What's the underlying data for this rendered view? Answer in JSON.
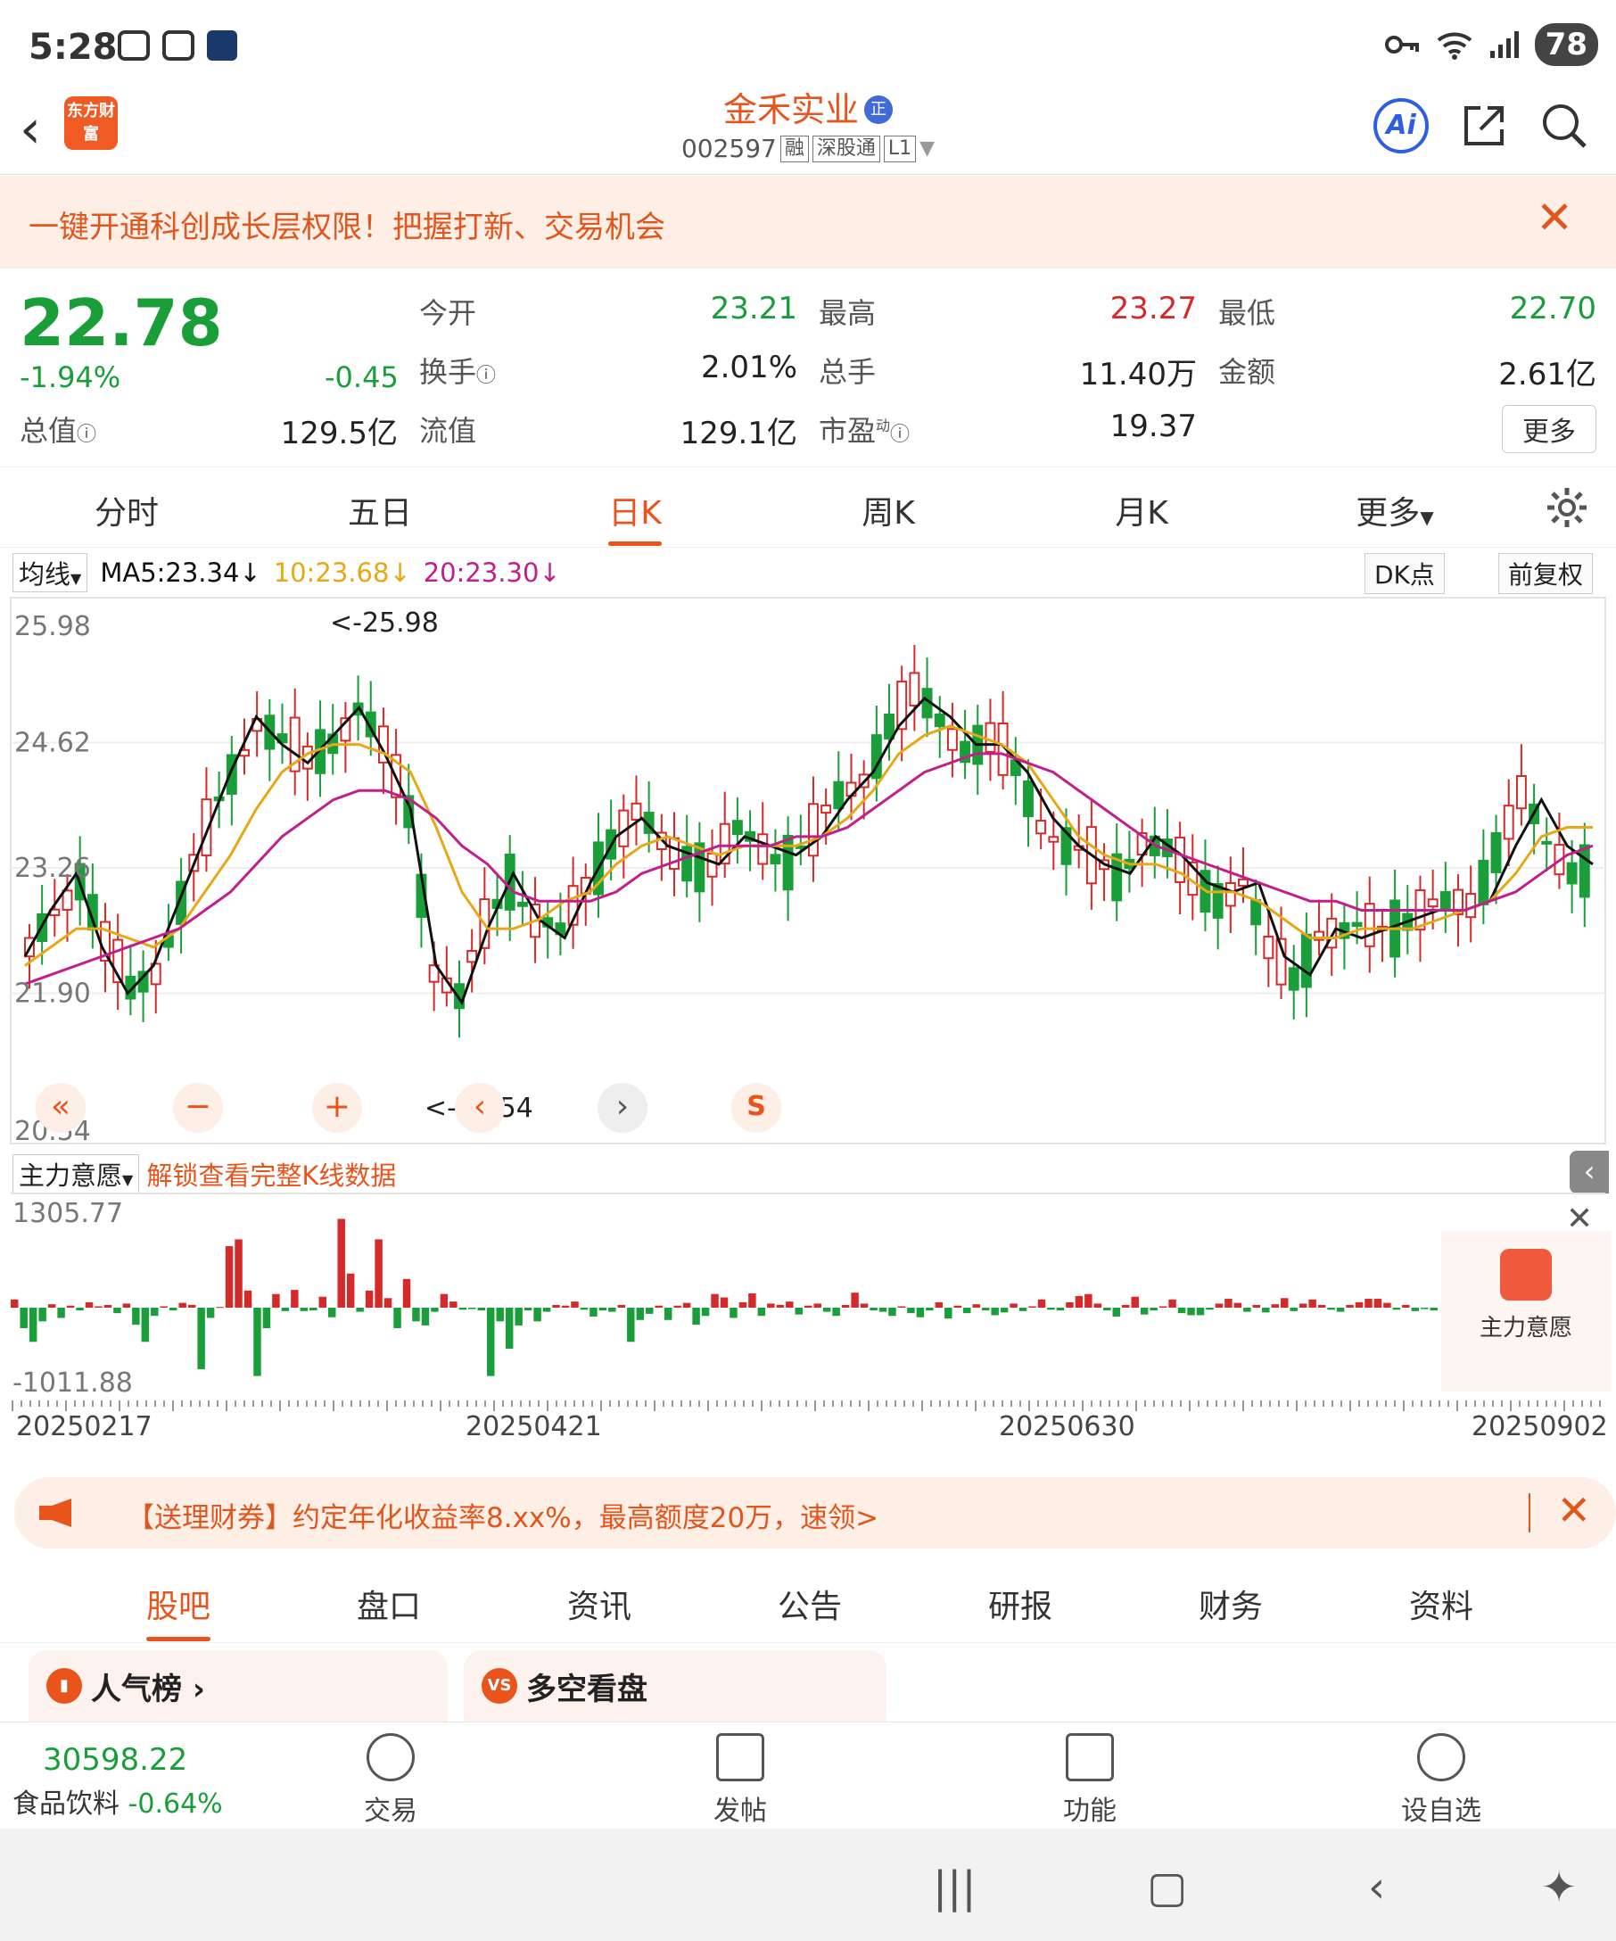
{
  "status": {
    "time": "5:28",
    "battery": "78"
  },
  "header": {
    "logo_text": "东方财富",
    "title": "金禾实业",
    "title_badge": "正",
    "code": "002597",
    "tags": [
      "融",
      "深股通",
      "L1"
    ],
    "ai_label": "Ai"
  },
  "banner": {
    "text": "一键开通科创成长层权限！把握打新、交易机会"
  },
  "quote": {
    "price": "22.78",
    "change_pct": "-1.94%",
    "change": "-0.45",
    "open_label": "今开",
    "open": "23.21",
    "high_label": "最高",
    "high": "23.27",
    "low_label": "最低",
    "low": "22.70",
    "turnover_label": "换手",
    "turnover": "2.01%",
    "volume_label": "总手",
    "volume": "11.40万",
    "amount_label": "金额",
    "amount": "2.61亿",
    "mktcap_label": "总值",
    "mktcap": "129.5亿",
    "float_label": "流值",
    "float": "129.1亿",
    "pe_label": "市盈",
    "pe_sup": "动",
    "pe": "19.37",
    "more": "更多"
  },
  "tabs": [
    "分时",
    "五日",
    "日K",
    "周K",
    "月K",
    "更多"
  ],
  "active_tab": "日K",
  "ma_legend": {
    "selector": "均线",
    "ma5": "MA5:23.34↓",
    "ma10": "10:23.68↓",
    "ma20": "20:23.30↓",
    "dk": "DK点",
    "fq": "前复权"
  },
  "chart_data": {
    "type": "candlestick",
    "yticks": [
      "25.98",
      "24.62",
      "23.26",
      "21.90",
      "20.54"
    ],
    "ylim": [
      20.54,
      25.98
    ],
    "max_label": "25.98",
    "min_label": "20.54",
    "colors": {
      "up": "#d42a2a",
      "down": "#1a9e3a",
      "ma5": "#111111",
      "ma10": "#e6a817",
      "ma20": "#c21f8a"
    },
    "ma5_approx": [
      22.3,
      22.8,
      23.2,
      22.4,
      21.9,
      22.2,
      22.9,
      23.6,
      24.3,
      24.9,
      24.6,
      24.4,
      24.7,
      25.0,
      24.5,
      23.9,
      22.2,
      21.8,
      22.6,
      23.2,
      22.7,
      22.5,
      23.1,
      23.6,
      23.8,
      23.5,
      23.4,
      23.3,
      23.6,
      23.5,
      23.4,
      23.6,
      24.0,
      24.3,
      24.8,
      25.1,
      24.9,
      24.6,
      24.6,
      24.3,
      23.8,
      23.5,
      23.3,
      23.2,
      23.6,
      23.4,
      23.1,
      23.0,
      23.1,
      22.3,
      22.1,
      22.6,
      22.5,
      22.6,
      22.7,
      22.8,
      22.8,
      22.9,
      23.5,
      24.0,
      23.5,
      23.3
    ],
    "ma10_approx": [
      22.2,
      22.4,
      22.6,
      22.6,
      22.5,
      22.4,
      22.6,
      23.0,
      23.4,
      23.9,
      24.3,
      24.5,
      24.6,
      24.6,
      24.5,
      24.3,
      23.7,
      23.0,
      22.6,
      22.6,
      22.7,
      22.9,
      23.0,
      23.3,
      23.5,
      23.6,
      23.5,
      23.4,
      23.5,
      23.5,
      23.5,
      23.6,
      23.8,
      24.1,
      24.5,
      24.7,
      24.8,
      24.7,
      24.6,
      24.4,
      24.0,
      23.6,
      23.4,
      23.3,
      23.3,
      23.2,
      23.0,
      23.0,
      22.9,
      22.7,
      22.5,
      22.5,
      22.6,
      22.6,
      22.6,
      22.7,
      22.8,
      22.9,
      23.2,
      23.6,
      23.7,
      23.7
    ],
    "ma20_approx": [
      22.0,
      22.1,
      22.2,
      22.3,
      22.4,
      22.5,
      22.6,
      22.8,
      23.0,
      23.3,
      23.6,
      23.8,
      24.0,
      24.1,
      24.1,
      24.0,
      23.8,
      23.5,
      23.3,
      23.0,
      22.9,
      22.9,
      22.9,
      23.0,
      23.2,
      23.3,
      23.4,
      23.5,
      23.5,
      23.5,
      23.6,
      23.6,
      23.7,
      23.9,
      24.1,
      24.3,
      24.4,
      24.5,
      24.5,
      24.4,
      24.3,
      24.1,
      23.9,
      23.7,
      23.5,
      23.4,
      23.3,
      23.2,
      23.1,
      23.0,
      22.9,
      22.9,
      22.8,
      22.8,
      22.8,
      22.8,
      22.8,
      22.9,
      23.0,
      23.2,
      23.4,
      23.5
    ]
  },
  "chart_controls": [
    "«",
    "−",
    "+",
    "‹",
    "›",
    "S"
  ],
  "volume_panel": {
    "selector": "主力意愿",
    "unlock": "解锁查看完整K线数据",
    "ymax": "1305.77",
    "ymin": "-1011.88",
    "side_label": "主力意愿",
    "values": [
      120,
      -300,
      -500,
      -200,
      50,
      -150,
      30,
      -40,
      80,
      20,
      40,
      -80,
      60,
      -250,
      -500,
      -120,
      20,
      -40,
      70,
      40,
      -900,
      -150,
      10,
      900,
      1000,
      250,
      -1000,
      -300,
      200,
      -50,
      260,
      -50,
      -40,
      160,
      -140,
      1300,
      500,
      -60,
      250,
      1000,
      140,
      -300,
      420,
      -200,
      -260,
      -60,
      200,
      90,
      -30,
      -20,
      -40,
      -1000,
      -200,
      -600,
      -260,
      -40,
      -200,
      -60,
      40,
      30,
      90,
      -30,
      -130,
      -40,
      -60,
      40,
      -500,
      -180,
      -90,
      30,
      -180,
      30,
      70,
      -250,
      -120,
      200,
      150,
      -150,
      80,
      210,
      -120,
      60,
      40,
      90,
      -100,
      30,
      60,
      -60,
      -120,
      40,
      220,
      60,
      -40,
      -60,
      -120,
      20,
      -80,
      -140,
      -40,
      80,
      -160,
      30,
      -80,
      50,
      -40,
      -110,
      -70,
      60,
      -50,
      20,
      120,
      -30,
      -40,
      80,
      170,
      200,
      60,
      -40,
      -130,
      40,
      160,
      -100,
      -40,
      20,
      120,
      -80,
      -110,
      -110,
      -30,
      60,
      130,
      70,
      -60,
      40,
      -70,
      50,
      140,
      -50,
      60,
      120,
      40,
      -30,
      -60,
      40,
      80,
      130,
      130,
      70,
      -30,
      40,
      -50,
      -20,
      -40
    ],
    "colors": {
      "pos": "#d42a2a",
      "neg": "#1a9e3a"
    }
  },
  "x_dates": [
    "20250217",
    "20250421",
    "20250630",
    "20250902"
  ],
  "ad": {
    "text": "【送理财券】约定年化收益率8.xx%，最高额度20万，速领>"
  },
  "bottom_tabs": [
    "股吧",
    "盘口",
    "资讯",
    "公告",
    "研报",
    "财务",
    "资料"
  ],
  "active_bottom_tab": "股吧",
  "cards": [
    {
      "icon": "rank-icon",
      "label": "人气榜 ›"
    },
    {
      "icon": "vs-icon",
      "label": "多空看盘"
    }
  ],
  "index": {
    "value": "30598.22",
    "name": "食品饮料",
    "change": "-0.64%"
  },
  "bottom_bar": [
    "交易",
    "发帖",
    "功能",
    "设自选"
  ]
}
